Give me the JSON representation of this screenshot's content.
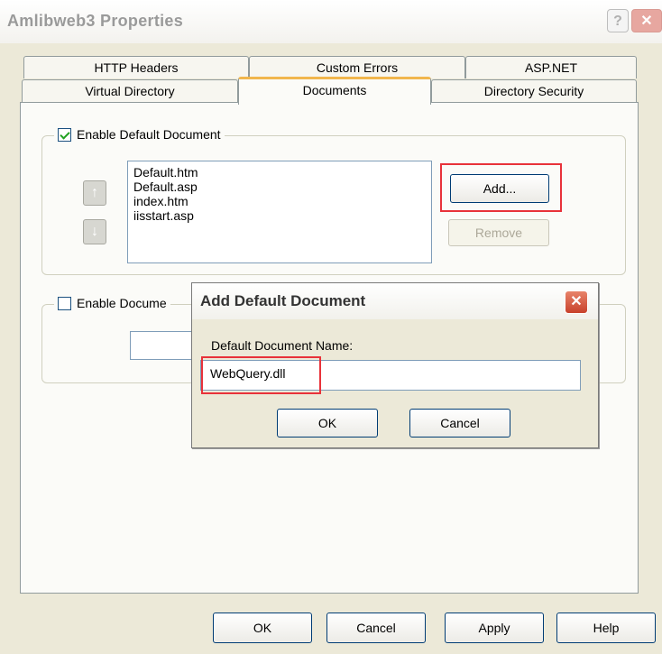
{
  "window": {
    "title": "Amlibweb3 Properties",
    "help_glyph": "?",
    "close_glyph": "✕"
  },
  "tabs": {
    "row1": [
      "HTTP Headers",
      "Custom Errors",
      "ASP.NET"
    ],
    "row2": [
      "Virtual Directory",
      "Documents",
      "Directory Security"
    ],
    "active": "Documents"
  },
  "default_doc": {
    "enable_label": "Enable Default Document",
    "enabled": true,
    "up_glyph": "↑",
    "down_glyph": "↓",
    "items": [
      "Default.htm",
      "Default.asp",
      "index.htm",
      "iisstart.asp"
    ],
    "add_label": "Add...",
    "remove_label": "Remove"
  },
  "footer_doc": {
    "enable_label": "Enable Docume",
    "enabled": false
  },
  "dialog": {
    "title": "Add Default Document",
    "close_glyph": "✕",
    "field_label": "Default Document Name:",
    "field_value": "WebQuery.dll",
    "ok_label": "OK",
    "cancel_label": "Cancel"
  },
  "buttons": {
    "ok": "OK",
    "cancel": "Cancel",
    "apply": "Apply",
    "help": "Help"
  },
  "colors": {
    "highlight": "#e8323a",
    "tab_accent": "#f1b64d",
    "face": "#ece9d8"
  }
}
